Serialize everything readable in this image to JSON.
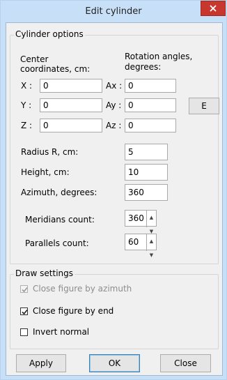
{
  "window": {
    "title": "Edit cylinder"
  },
  "cylinder_options": {
    "group_label": "Cylinder options",
    "center_label": "Center\ncoordinates, cm:",
    "center_label_line1": "Center",
    "center_label_line2": "coordinates, cm:",
    "rotation_label_line1": "Rotation angles,",
    "rotation_label_line2": "degrees:",
    "x_label": "X :",
    "x_value": "0",
    "y_label": "Y :",
    "y_value": "0",
    "z_label": "Z :",
    "z_value": "0",
    "ax_label": "Ax :",
    "ax_value": "0",
    "ay_label": "Ay :",
    "ay_value": "0",
    "az_label": "Az :",
    "az_value": "0",
    "e_button": "E",
    "radius_label": "Radius R, cm:",
    "radius_value": "5",
    "height_label": "Height, cm:",
    "height_value": "10",
    "azimuth_label": "Azimuth, degrees:",
    "azimuth_value": "360",
    "meridians_label": "Meridians count:",
    "meridians_value": "360",
    "parallels_label": "Parallels count:",
    "parallels_value": "60"
  },
  "draw_settings": {
    "group_label": "Draw settings",
    "close_by_azimuth": {
      "label": "Close figure by azimuth",
      "checked": true,
      "enabled": false
    },
    "close_by_end": {
      "label": "Close figure by end",
      "checked": true,
      "enabled": true
    },
    "invert_normal": {
      "label": "Invert normal",
      "checked": false,
      "enabled": true
    }
  },
  "buttons": {
    "apply": "Apply",
    "ok": "OK",
    "close": "Close"
  },
  "colors": {
    "titlebar": "#c8e0f7",
    "close_button": "#c8372e",
    "dialog_bg": "#f0f0f0"
  }
}
